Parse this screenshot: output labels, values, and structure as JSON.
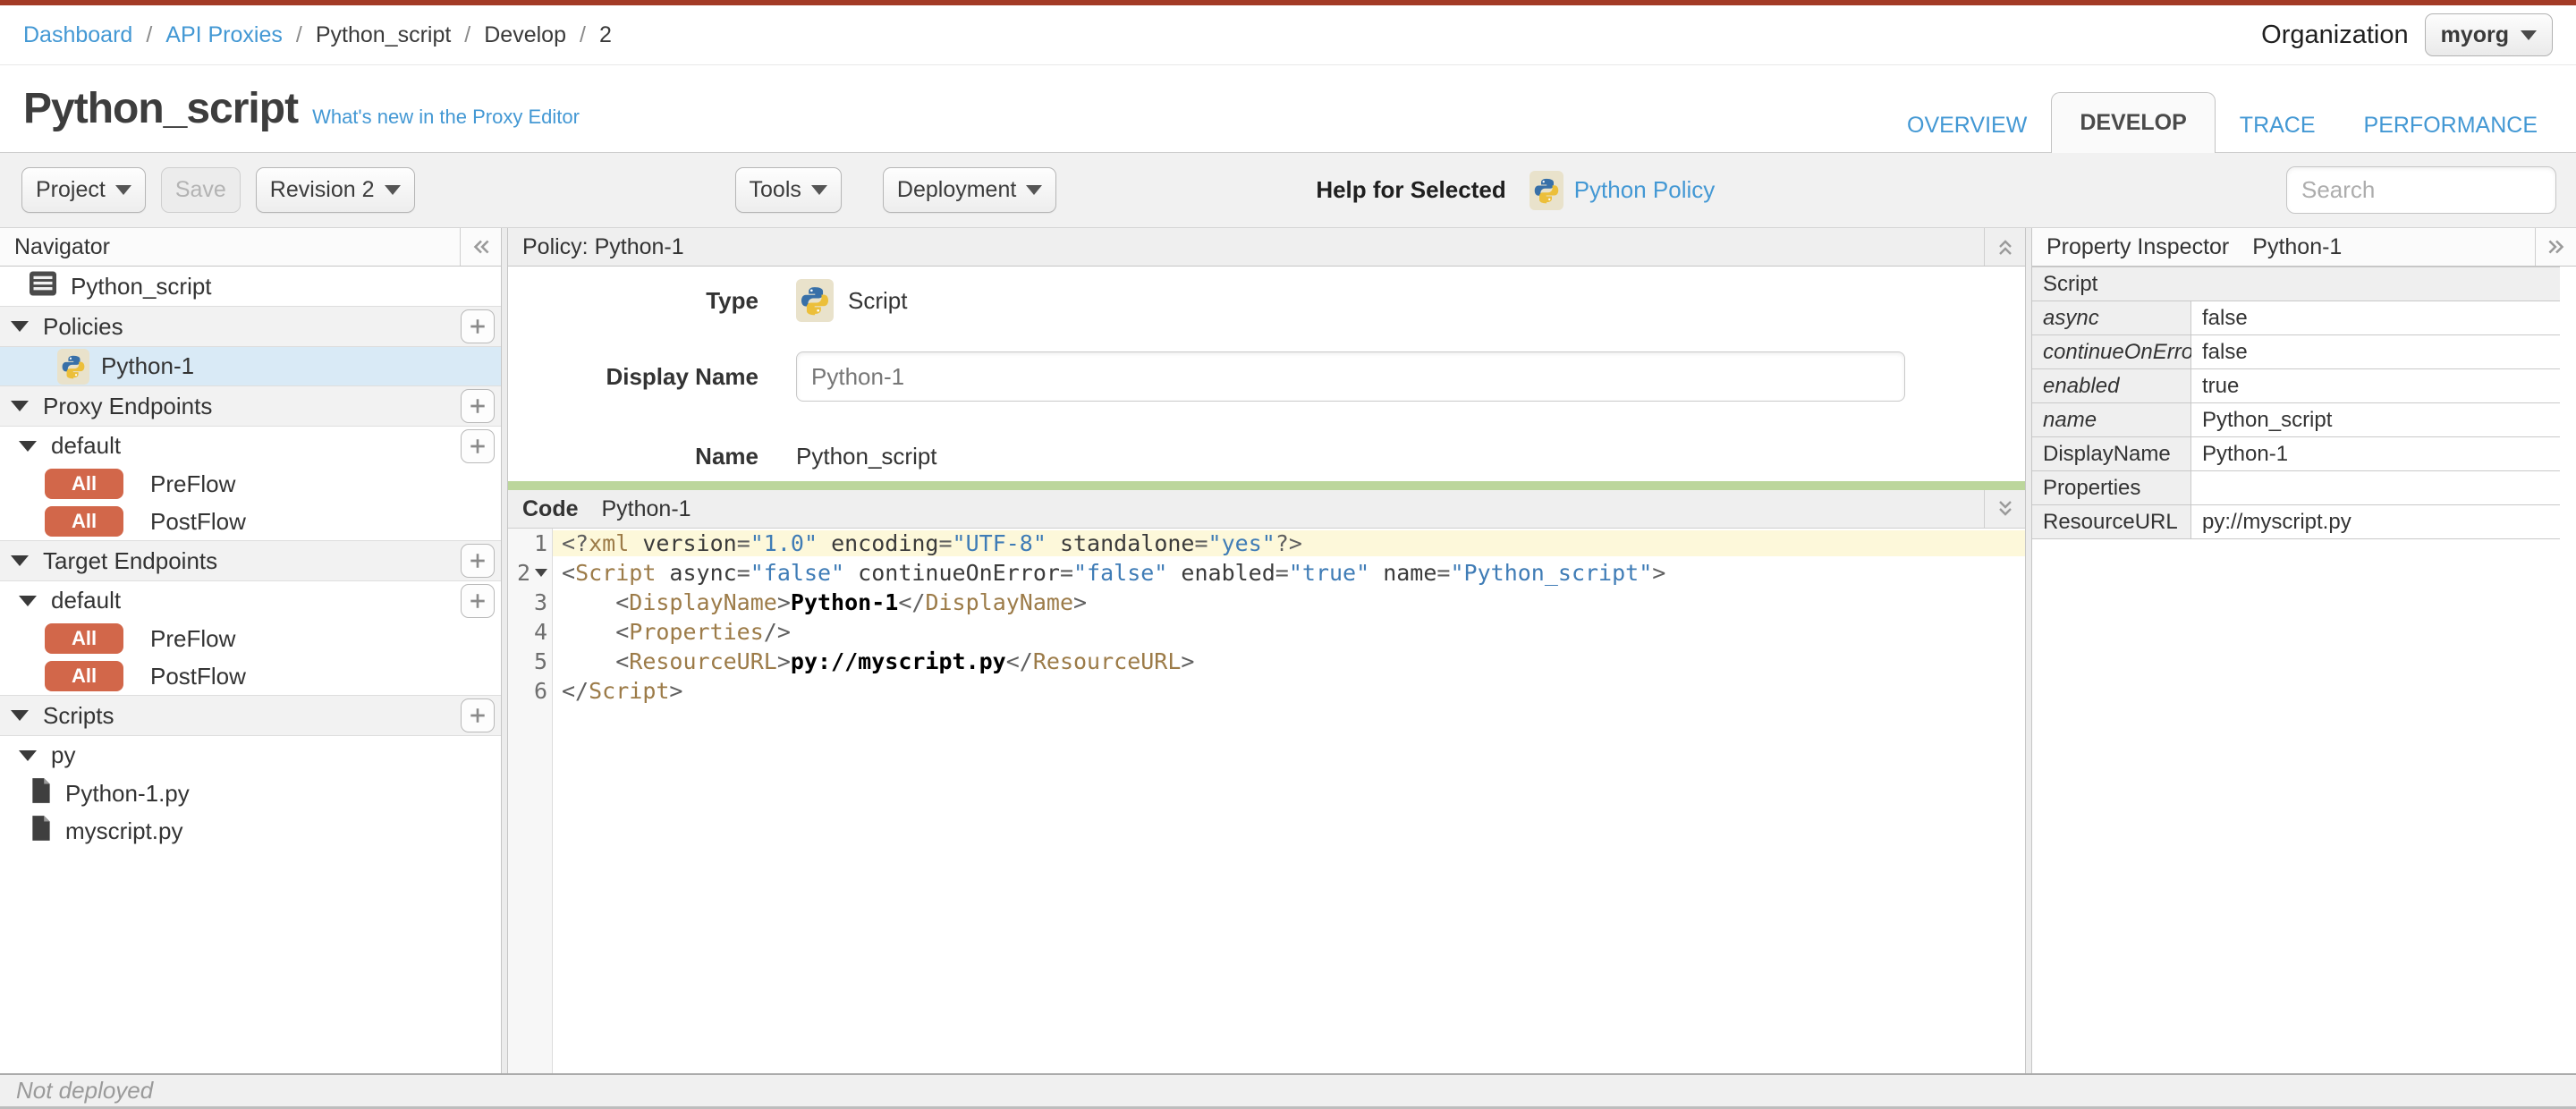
{
  "topbar": {
    "accent_color": "#a33b26",
    "breadcrumb": {
      "separator": "/",
      "items": [
        {
          "label": "Dashboard",
          "link": true
        },
        {
          "label": "API Proxies",
          "link": true
        },
        {
          "label": "Python_script",
          "link": false
        },
        {
          "label": "Develop",
          "link": false
        },
        {
          "label": "2",
          "link": false
        }
      ]
    },
    "organization": {
      "label": "Organization",
      "value": "myorg"
    }
  },
  "header": {
    "title": "Python_script",
    "whats_new_link": "What's new in the Proxy Editor",
    "tabs": [
      {
        "label": "OVERVIEW",
        "active": false
      },
      {
        "label": "DEVELOP",
        "active": true
      },
      {
        "label": "TRACE",
        "active": false
      },
      {
        "label": "PERFORMANCE",
        "active": false
      }
    ]
  },
  "toolbar": {
    "project_button": "Project",
    "save_button": "Save",
    "revision_button": "Revision 2",
    "tools_button": "Tools",
    "deployment_button": "Deployment",
    "help_label": "Help for Selected",
    "policy_help_icon": "python-logo-icon",
    "policy_help_link": "Python Policy",
    "search_placeholder": "Search"
  },
  "navigator": {
    "title": "Navigator",
    "collapse_icon": "double-chevron-left-icon",
    "items": [
      {
        "type": "item",
        "icon": "proxy-overview",
        "indent": "top",
        "label": "Python_script"
      },
      {
        "type": "section",
        "label": "Policies",
        "add": true
      },
      {
        "type": "item",
        "icon": "python",
        "indent": "policy",
        "label": "Python-1",
        "selected": true
      },
      {
        "type": "section",
        "label": "Proxy Endpoints",
        "add": true
      },
      {
        "type": "subsection",
        "label": "default",
        "add": true
      },
      {
        "type": "flow",
        "badge": "All",
        "label": "PreFlow"
      },
      {
        "type": "flow",
        "badge": "All",
        "label": "PostFlow"
      },
      {
        "type": "section",
        "label": "Target Endpoints",
        "add": true
      },
      {
        "type": "subsection",
        "label": "default",
        "add": true
      },
      {
        "type": "flow",
        "badge": "All",
        "label": "PreFlow"
      },
      {
        "type": "flow",
        "badge": "All",
        "label": "PostFlow"
      },
      {
        "type": "section",
        "label": "Scripts",
        "add": true
      },
      {
        "type": "subsection",
        "label": "py",
        "add": false
      },
      {
        "type": "item",
        "icon": "file",
        "indent": "file",
        "label": "Python-1.py"
      },
      {
        "type": "item",
        "icon": "file",
        "indent": "file",
        "label": "myscript.py"
      }
    ]
  },
  "policy": {
    "header": "Policy: Python-1",
    "collapse_icon": "double-chevron-up-icon",
    "type_label": "Type",
    "type_icon": "python-logo-icon",
    "type_value": "Script",
    "display_name_label": "Display Name",
    "display_name_value": "Python-1",
    "name_label": "Name",
    "name_value": "Python_script"
  },
  "code": {
    "panel_label": "Code",
    "policy_name": "Python-1",
    "collapse_icon": "double-chevron-down-icon",
    "active_line_color": "#fdf8da",
    "lines": [
      {
        "num": 1,
        "active": true,
        "tokens": [
          [
            "p",
            "<?"
          ],
          [
            "t",
            "xml"
          ],
          [
            "a",
            " version"
          ],
          [
            "p",
            "="
          ],
          [
            "s",
            "\"1.0\""
          ],
          [
            "a",
            " encoding"
          ],
          [
            "p",
            "="
          ],
          [
            "s",
            "\"UTF-8\""
          ],
          [
            "a",
            " standalone"
          ],
          [
            "p",
            "="
          ],
          [
            "s",
            "\"yes\""
          ],
          [
            "p",
            "?>"
          ]
        ]
      },
      {
        "num": 2,
        "fold": true,
        "tokens": [
          [
            "p",
            "<"
          ],
          [
            "t",
            "Script"
          ],
          [
            "a",
            " async"
          ],
          [
            "p",
            "="
          ],
          [
            "s",
            "\"false\""
          ],
          [
            "a",
            " continueOnError"
          ],
          [
            "p",
            "="
          ],
          [
            "s",
            "\"false\""
          ],
          [
            "a",
            " enabled"
          ],
          [
            "p",
            "="
          ],
          [
            "s",
            "\"true\""
          ],
          [
            "a",
            " name"
          ],
          [
            "p",
            "="
          ],
          [
            "s",
            "\"Python_script\""
          ],
          [
            "p",
            ">"
          ]
        ]
      },
      {
        "num": 3,
        "tokens": [
          [
            "p",
            "    <"
          ],
          [
            "t",
            "DisplayName"
          ],
          [
            "p",
            ">"
          ],
          [
            "x",
            "Python-1"
          ],
          [
            "p",
            "</"
          ],
          [
            "t",
            "DisplayName"
          ],
          [
            "p",
            ">"
          ]
        ]
      },
      {
        "num": 4,
        "tokens": [
          [
            "p",
            "    <"
          ],
          [
            "t",
            "Properties"
          ],
          [
            "p",
            "/>"
          ]
        ]
      },
      {
        "num": 5,
        "tokens": [
          [
            "p",
            "    <"
          ],
          [
            "t",
            "ResourceURL"
          ],
          [
            "p",
            ">"
          ],
          [
            "x",
            "py://myscript.py"
          ],
          [
            "p",
            "</"
          ],
          [
            "t",
            "ResourceURL"
          ],
          [
            "p",
            ">"
          ]
        ]
      },
      {
        "num": 6,
        "tokens": [
          [
            "p",
            "</"
          ],
          [
            "t",
            "Script"
          ],
          [
            "p",
            ">"
          ]
        ]
      }
    ]
  },
  "inspector": {
    "title": "Property Inspector",
    "policy_name": "Python-1",
    "expand_icon": "double-chevron-right-icon",
    "rows": [
      {
        "kind": "section",
        "label": "Script"
      },
      {
        "kind": "property",
        "label": "async",
        "italic": true,
        "value": "false"
      },
      {
        "kind": "property",
        "label": "continueOnError",
        "italic": true,
        "value": "false"
      },
      {
        "kind": "property",
        "label": "enabled",
        "italic": true,
        "value": "true"
      },
      {
        "kind": "property",
        "label": "name",
        "italic": true,
        "value": "Python_script"
      },
      {
        "kind": "property",
        "label": "DisplayName",
        "italic": false,
        "value": "Python-1"
      },
      {
        "kind": "property",
        "label": "Properties",
        "italic": false,
        "value": ""
      },
      {
        "kind": "property",
        "label": "ResourceURL",
        "italic": false,
        "value": "py://myscript.py"
      }
    ]
  },
  "statusbar": {
    "text": "Not deployed"
  },
  "colors": {
    "accent_link": "#4398d4",
    "badge_all": "#d2674a",
    "selected_row": "#d9eaf6",
    "resize_handle_green": "#bcd69c",
    "code_tag": "#9c7b48",
    "code_string": "#3f7cb6"
  }
}
